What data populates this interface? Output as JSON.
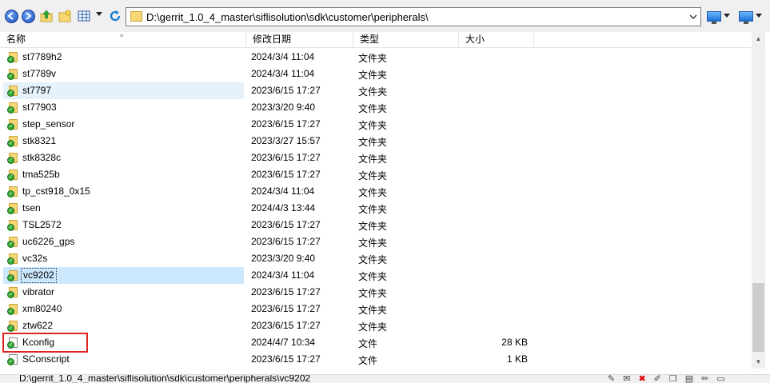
{
  "address": {
    "path": "D:\\gerrit_1.0_4_master\\siflisolution\\sdk\\customer\\peripherals\\"
  },
  "columns": {
    "name": "名称",
    "modified": "修改日期",
    "type": "类型",
    "size": "大小"
  },
  "rows": [
    {
      "name": "st7789h2",
      "modified": "2024/3/4 11:04",
      "type": "文件夹",
      "size": "",
      "kind": "folder"
    },
    {
      "name": "st7789v",
      "modified": "2024/3/4 11:04",
      "type": "文件夹",
      "size": "",
      "kind": "folder"
    },
    {
      "name": "st7797",
      "modified": "2023/6/15 17:27",
      "type": "文件夹",
      "size": "",
      "kind": "folder"
    },
    {
      "name": "st77903",
      "modified": "2023/3/20 9:40",
      "type": "文件夹",
      "size": "",
      "kind": "folder"
    },
    {
      "name": "step_sensor",
      "modified": "2023/6/15 17:27",
      "type": "文件夹",
      "size": "",
      "kind": "folder"
    },
    {
      "name": "stk8321",
      "modified": "2023/3/27 15:57",
      "type": "文件夹",
      "size": "",
      "kind": "folder"
    },
    {
      "name": "stk8328c",
      "modified": "2023/6/15 17:27",
      "type": "文件夹",
      "size": "",
      "kind": "folder"
    },
    {
      "name": "tma525b",
      "modified": "2023/6/15 17:27",
      "type": "文件夹",
      "size": "",
      "kind": "folder"
    },
    {
      "name": "tp_cst918_0x15",
      "modified": "2024/3/4 11:04",
      "type": "文件夹",
      "size": "",
      "kind": "folder"
    },
    {
      "name": "tsen",
      "modified": "2024/4/3 13:44",
      "type": "文件夹",
      "size": "",
      "kind": "folder"
    },
    {
      "name": "TSL2572",
      "modified": "2023/6/15 17:27",
      "type": "文件夹",
      "size": "",
      "kind": "folder"
    },
    {
      "name": "uc6226_gps",
      "modified": "2023/6/15 17:27",
      "type": "文件夹",
      "size": "",
      "kind": "folder"
    },
    {
      "name": "vc32s",
      "modified": "2023/3/20 9:40",
      "type": "文件夹",
      "size": "",
      "kind": "folder"
    },
    {
      "name": "vc9202",
      "modified": "2024/3/4 11:04",
      "type": "文件夹",
      "size": "",
      "kind": "folder"
    },
    {
      "name": "vibrator",
      "modified": "2023/6/15 17:27",
      "type": "文件夹",
      "size": "",
      "kind": "folder"
    },
    {
      "name": "xm80240",
      "modified": "2023/6/15 17:27",
      "type": "文件夹",
      "size": "",
      "kind": "folder"
    },
    {
      "name": "ztw622",
      "modified": "2023/6/15 17:27",
      "type": "文件夹",
      "size": "",
      "kind": "folder"
    },
    {
      "name": "Kconfig",
      "modified": "2024/4/7 10:34",
      "type": "文件",
      "size": "28 KB",
      "kind": "file"
    },
    {
      "name": "SConscript",
      "modified": "2023/6/15 17:27",
      "type": "文件",
      "size": "1 KB",
      "kind": "file"
    }
  ],
  "status": {
    "text": "D:\\gerrit_1.0_4_master\\siflisolution\\sdk\\customer\\peripherals\\vc9202"
  },
  "colors": {
    "selection": "#cce8ff",
    "hover": "#e5f1fb",
    "highlight_box": "#e02424",
    "vcs_ok": "#2fa82f"
  }
}
